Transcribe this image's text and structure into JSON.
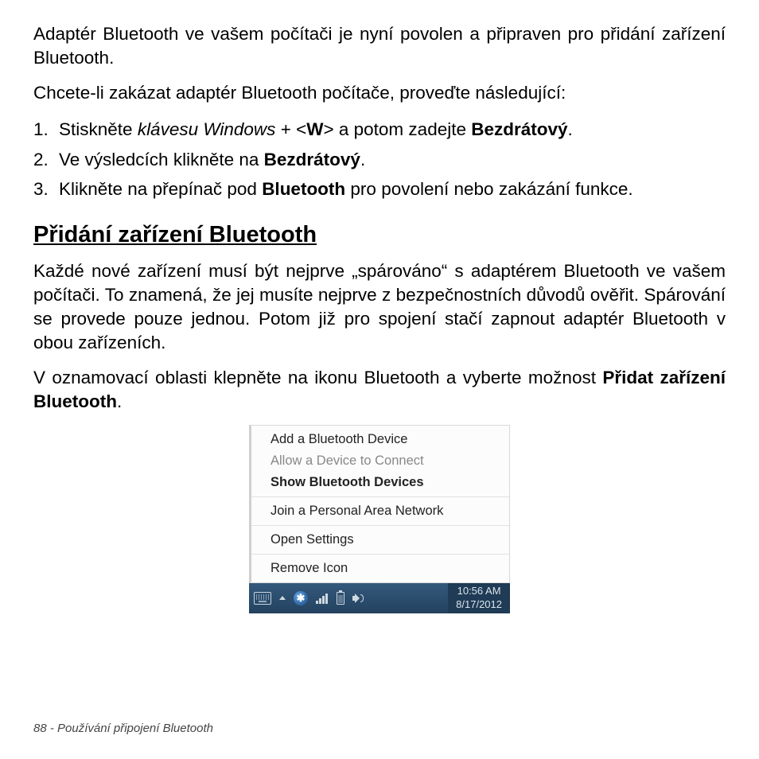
{
  "para1": "Adaptér Bluetooth ve vašem počítači je nyní povolen a připraven pro přidání zařízení Bluetooth.",
  "para2": "Chcete-li zakázat adaptér Bluetooth počítače, proveďte následující:",
  "steps": [
    {
      "num": "1.",
      "a": "Stiskněte ",
      "i": "klávesu Windows",
      "b": " + <",
      "k": "W",
      "c": "> a potom zadejte ",
      "d": "Bezdrátový",
      "e": "."
    },
    {
      "num": "2.",
      "a": "Ve výsledcích klikněte na ",
      "d": "Bezdrátový",
      "e": "."
    },
    {
      "num": "3.",
      "a": "Klikněte na přepínač pod ",
      "d": "Bluetooth",
      "e": " pro povolení nebo zakázání funkce."
    }
  ],
  "heading": "Přidání zařízení Bluetooth",
  "para3": "Každé nové zařízení musí být nejprve „spárováno“ s adaptérem Bluetooth ve vašem počítači. To znamená, že jej musíte nejprve z bezpečnostních důvodů ověřit. Spárování se provede pouze jednou. Potom již pro spojení stačí zapnout adaptér Bluetooth v obou zařízeních.",
  "para4a": "V oznamovací oblasti klepněte na ikonu Bluetooth a vyberte možnost ",
  "para4b": "Přidat zařízení Bluetooth",
  "para4c": ".",
  "menu": {
    "add": "Add a Bluetooth Device",
    "allow": "Allow a Device to Connect",
    "show": "Show Bluetooth Devices",
    "join": "Join a Personal Area Network",
    "open": "Open Settings",
    "remove": "Remove Icon"
  },
  "taskbar": {
    "bt_glyph": "✱",
    "time": "10:56 AM",
    "date": "8/17/2012"
  },
  "footer": "88 - Používání připojení Bluetooth"
}
